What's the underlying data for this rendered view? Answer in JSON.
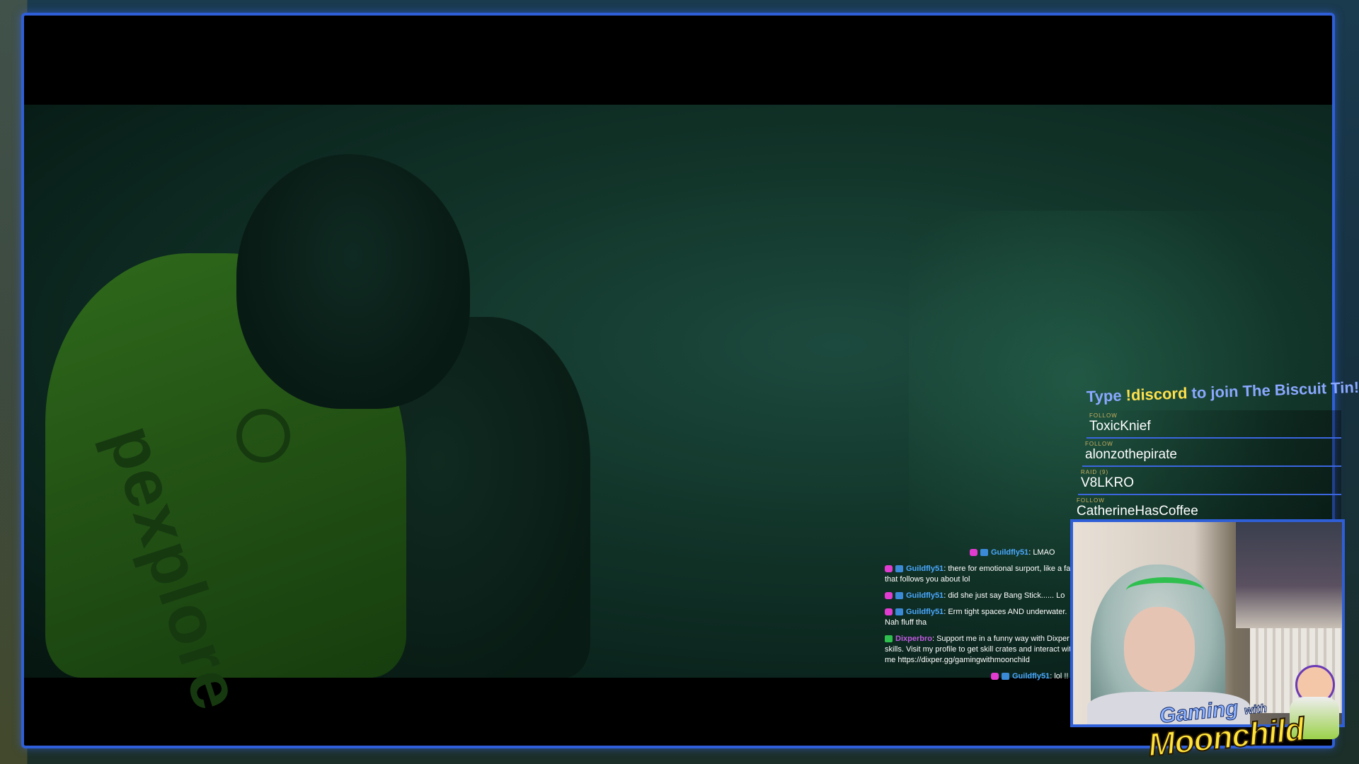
{
  "alert_banner": {
    "prefix": "Type ",
    "command": "!discord",
    "suffix": " to join The Biscuit Tin!"
  },
  "events": [
    {
      "type": "FOLLOW",
      "name": "ToxicKnief"
    },
    {
      "type": "FOLLOW",
      "name": "alonzothepirate"
    },
    {
      "type": "RAID (9)",
      "name": "V8LKRO"
    },
    {
      "type": "FOLLOW",
      "name": "CatherineHasCoffee"
    }
  ],
  "game": {
    "tank_brand": "pexplore"
  },
  "chat": [
    {
      "user": "Guildfly51",
      "text": "LMAO"
    },
    {
      "user": "Guildfly51",
      "text": "there for emotional surport, like a fart that follows you about lol"
    },
    {
      "user": "Guildfly51",
      "text": "did she just say Bang Stick...... Lo"
    },
    {
      "user": "Guildfly51",
      "text": "Erm tight spaces AND underwater. Nah fluff tha"
    },
    {
      "user": "Dixperbro",
      "text": "Support me in a funny way with Dixper skills. Visit my profile to get skill crates and interact with me https://dixper.gg/gamingwithmoonchild"
    },
    {
      "user": "Guildfly51",
      "text": "lol !!"
    }
  ],
  "brand": {
    "top": "Gaming",
    "with": "with",
    "bottom": "Moonchild"
  },
  "colors": {
    "frame_border": "#2f5fd8",
    "highlight": "#ffe14a",
    "chat_user": "#4aa8ff"
  }
}
